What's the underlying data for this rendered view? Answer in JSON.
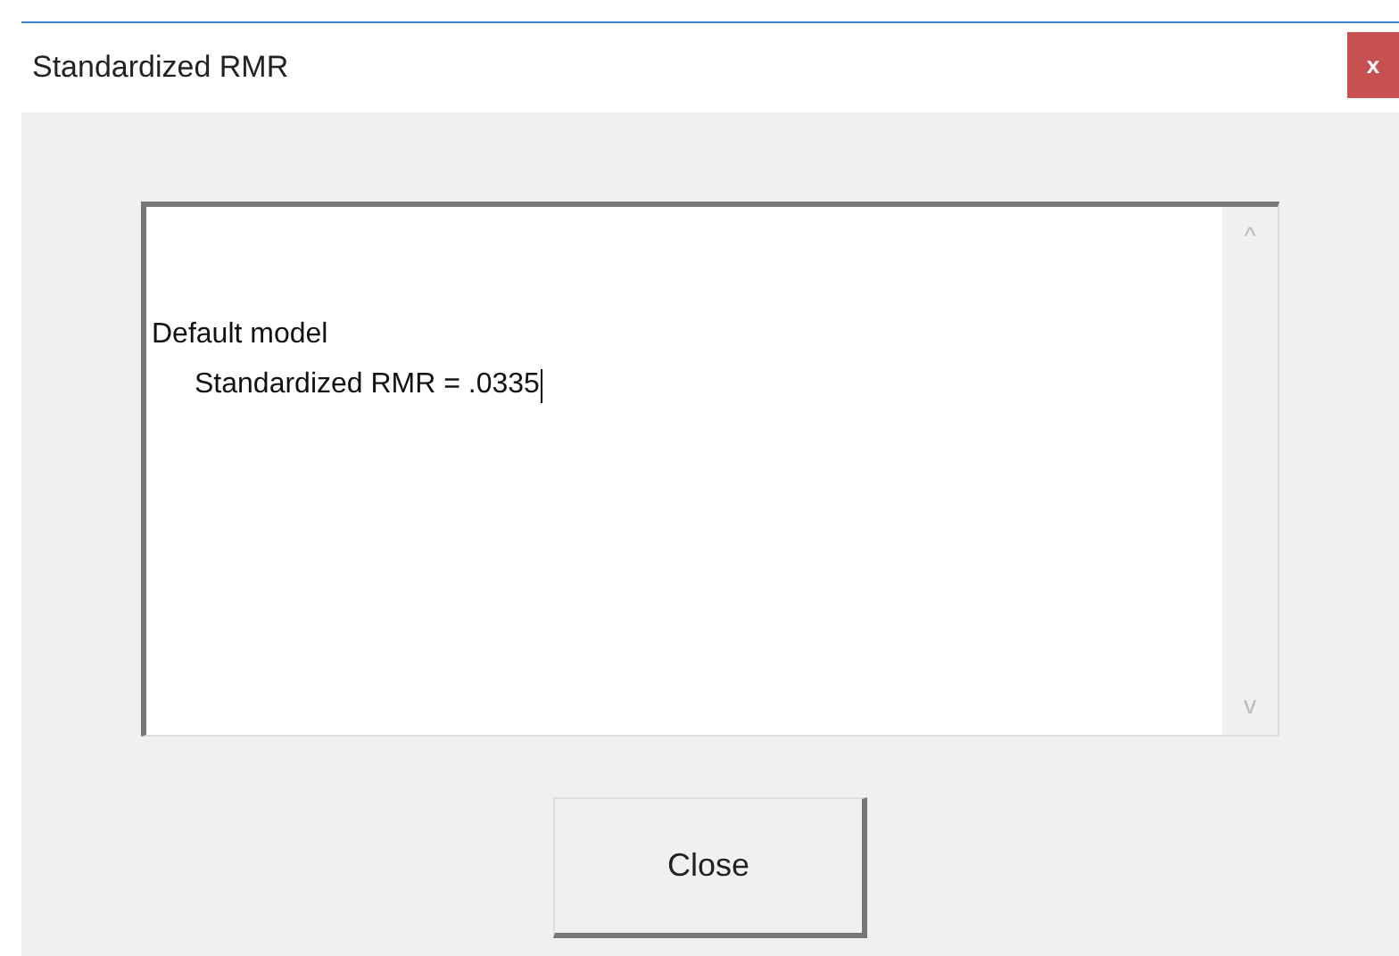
{
  "window": {
    "title": "Standardized RMR",
    "close_glyph": "x"
  },
  "output": {
    "lines": [
      {
        "text": "Default model",
        "children": [
          {
            "text": "Standardized RMR = .0335"
          }
        ]
      }
    ],
    "scroll_up": "^",
    "scroll_down": "v"
  },
  "buttons": [
    "Close"
  ]
}
